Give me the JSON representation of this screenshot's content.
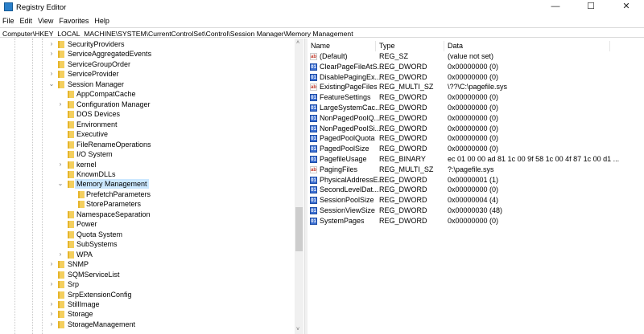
{
  "window": {
    "title": "Registry Editor",
    "minimize": "—",
    "maximize": "☐",
    "close": "✕"
  },
  "menu": [
    "File",
    "Edit",
    "View",
    "Favorites",
    "Help"
  ],
  "address": "Computer\\HKEY_LOCAL_MACHINE\\SYSTEM\\CurrentControlSet\\Control\\Session Manager\\Memory Management",
  "tree": [
    {
      "label": "SecurityProviders",
      "level": 1,
      "exp": ">"
    },
    {
      "label": "ServiceAggregatedEvents",
      "level": 1,
      "exp": ">"
    },
    {
      "label": "ServiceGroupOrder",
      "level": 1,
      "exp": ""
    },
    {
      "label": "ServiceProvider",
      "level": 1,
      "exp": ">"
    },
    {
      "label": "Session Manager",
      "level": 1,
      "exp": "v"
    },
    {
      "label": "AppCompatCache",
      "level": 2,
      "exp": ""
    },
    {
      "label": "Configuration Manager",
      "level": 2,
      "exp": ">"
    },
    {
      "label": "DOS Devices",
      "level": 2,
      "exp": ""
    },
    {
      "label": "Environment",
      "level": 2,
      "exp": ""
    },
    {
      "label": "Executive",
      "level": 2,
      "exp": ""
    },
    {
      "label": "FileRenameOperations",
      "level": 2,
      "exp": ""
    },
    {
      "label": "I/O System",
      "level": 2,
      "exp": ""
    },
    {
      "label": "kernel",
      "level": 2,
      "exp": ">"
    },
    {
      "label": "KnownDLLs",
      "level": 2,
      "exp": ""
    },
    {
      "label": "Memory Management",
      "level": 2,
      "exp": "v",
      "selected": true
    },
    {
      "label": "PrefetchParameters",
      "level": 3,
      "exp": ""
    },
    {
      "label": "StoreParameters",
      "level": 3,
      "exp": ""
    },
    {
      "label": "NamespaceSeparation",
      "level": 2,
      "exp": ""
    },
    {
      "label": "Power",
      "level": 2,
      "exp": ""
    },
    {
      "label": "Quota System",
      "level": 2,
      "exp": ""
    },
    {
      "label": "SubSystems",
      "level": 2,
      "exp": ""
    },
    {
      "label": "WPA",
      "level": 2,
      "exp": ">"
    },
    {
      "label": "SNMP",
      "level": 1,
      "exp": ">"
    },
    {
      "label": "SQMServiceList",
      "level": 1,
      "exp": ""
    },
    {
      "label": "Srp",
      "level": 1,
      "exp": ">"
    },
    {
      "label": "SrpExtensionConfig",
      "level": 1,
      "exp": ""
    },
    {
      "label": "StillImage",
      "level": 1,
      "exp": ">"
    },
    {
      "label": "Storage",
      "level": 1,
      "exp": ">"
    },
    {
      "label": "StorageManagement",
      "level": 1,
      "exp": ">"
    }
  ],
  "columns": {
    "name": "Name",
    "type": "Type",
    "data": "Data"
  },
  "values": [
    {
      "icon": "string",
      "name": "(Default)",
      "type": "REG_SZ",
      "data": "(value not set)"
    },
    {
      "icon": "binary",
      "name": "ClearPageFileAtS...",
      "type": "REG_DWORD",
      "data": "0x00000000 (0)"
    },
    {
      "icon": "binary",
      "name": "DisablePagingEx...",
      "type": "REG_DWORD",
      "data": "0x00000000 (0)"
    },
    {
      "icon": "string",
      "name": "ExistingPageFiles",
      "type": "REG_MULTI_SZ",
      "data": "\\??\\C:\\pagefile.sys"
    },
    {
      "icon": "binary",
      "name": "FeatureSettings",
      "type": "REG_DWORD",
      "data": "0x00000000 (0)"
    },
    {
      "icon": "binary",
      "name": "LargeSystemCac...",
      "type": "REG_DWORD",
      "data": "0x00000000 (0)"
    },
    {
      "icon": "binary",
      "name": "NonPagedPoolQ...",
      "type": "REG_DWORD",
      "data": "0x00000000 (0)"
    },
    {
      "icon": "binary",
      "name": "NonPagedPoolSi...",
      "type": "REG_DWORD",
      "data": "0x00000000 (0)"
    },
    {
      "icon": "binary",
      "name": "PagedPoolQuota",
      "type": "REG_DWORD",
      "data": "0x00000000 (0)"
    },
    {
      "icon": "binary",
      "name": "PagedPoolSize",
      "type": "REG_DWORD",
      "data": "0x00000000 (0)"
    },
    {
      "icon": "binary",
      "name": "PagefileUsage",
      "type": "REG_BINARY",
      "data": "ec 01 00 00 ad 81 1c 00 9f 58 1c 00 4f 87 1c 00 d1 ..."
    },
    {
      "icon": "string",
      "name": "PagingFiles",
      "type": "REG_MULTI_SZ",
      "data": "?:\\pagefile.sys"
    },
    {
      "icon": "binary",
      "name": "PhysicalAddressE...",
      "type": "REG_DWORD",
      "data": "0x00000001 (1)"
    },
    {
      "icon": "binary",
      "name": "SecondLevelDat...",
      "type": "REG_DWORD",
      "data": "0x00000000 (0)"
    },
    {
      "icon": "binary",
      "name": "SessionPoolSize",
      "type": "REG_DWORD",
      "data": "0x00000004 (4)"
    },
    {
      "icon": "binary",
      "name": "SessionViewSize",
      "type": "REG_DWORD",
      "data": "0x00000030 (48)"
    },
    {
      "icon": "binary",
      "name": "SystemPages",
      "type": "REG_DWORD",
      "data": "0x00000000 (0)"
    }
  ]
}
